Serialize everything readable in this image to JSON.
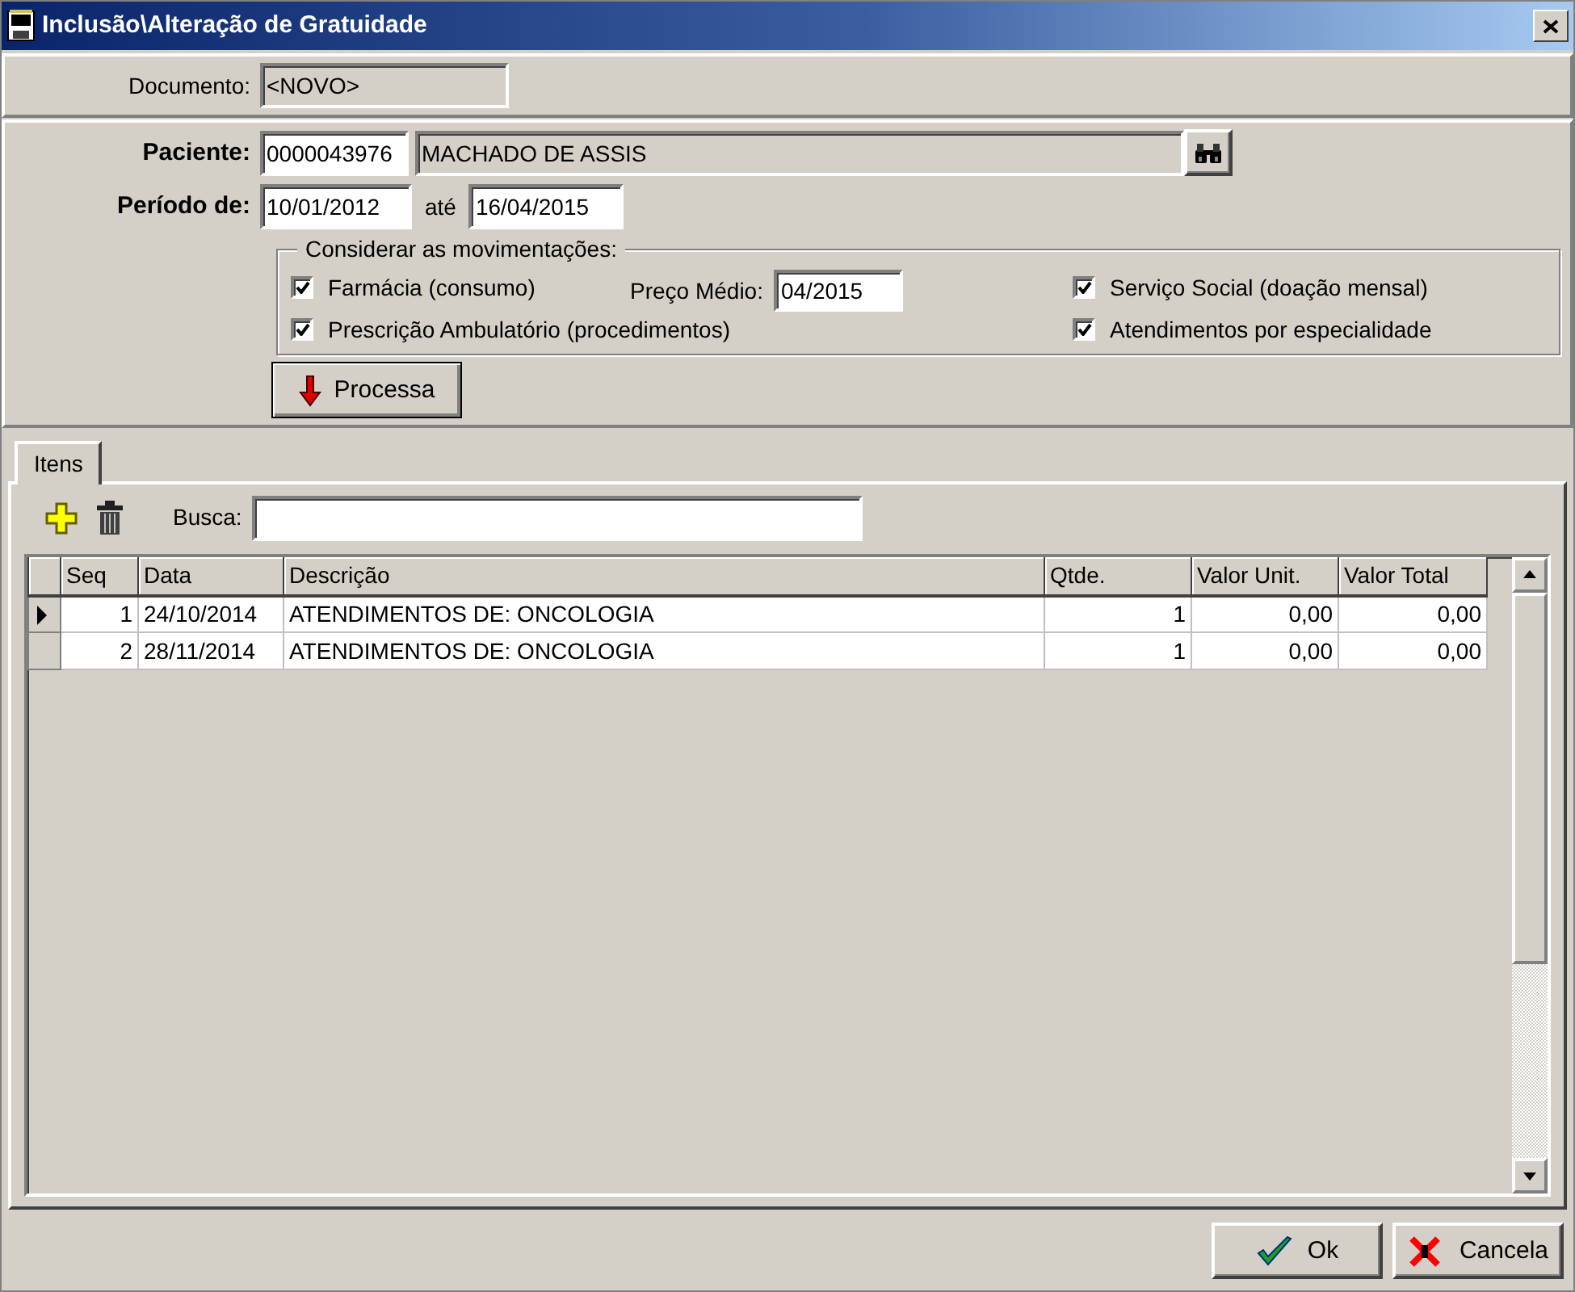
{
  "window": {
    "title": "Inclusão\\Alteração de Gratuidade"
  },
  "documento": {
    "label": "Documento:",
    "value": "<NOVO>"
  },
  "paciente": {
    "label": "Paciente:",
    "code": "0000043976",
    "name": "MACHADO DE ASSIS"
  },
  "periodo": {
    "label": "Período de:",
    "from": "10/01/2012",
    "separator": "até",
    "to": "16/04/2015"
  },
  "movimentacoes": {
    "title": "Considerar as movimentações:",
    "left": [
      {
        "label": "Farmácia  (consumo)",
        "checked": true
      },
      {
        "label": "Prescrição Ambulatório  (procedimentos)",
        "checked": true
      }
    ],
    "preco_medio": {
      "label": "Preço Médio:",
      "value": "04/2015"
    },
    "right": [
      {
        "label": "Serviço Social  (doação mensal)",
        "checked": true
      },
      {
        "label": "Atendimentos por especialidade",
        "checked": true
      }
    ]
  },
  "process_button": "Processa",
  "tabs": [
    {
      "label": "Itens",
      "selected": true
    }
  ],
  "search": {
    "label": "Busca:"
  },
  "table": {
    "columns": [
      "Seq",
      "Data",
      "Descrição",
      "Qtde.",
      "Valor Unit.",
      "Valor Total"
    ],
    "rows": [
      {
        "current": true,
        "cells": [
          "1",
          "24/10/2014",
          "ATENDIMENTOS DE: ONCOLOGIA",
          "1",
          "0,00",
          "0,00"
        ]
      },
      {
        "current": false,
        "cells": [
          "2",
          "28/11/2014",
          "ATENDIMENTOS DE: ONCOLOGIA",
          "1",
          "0,00",
          "0,00"
        ]
      }
    ]
  },
  "buttons": [
    {
      "kind": "ok",
      "label": "Ok"
    },
    {
      "kind": "cancel",
      "label": "Cancela"
    }
  ]
}
